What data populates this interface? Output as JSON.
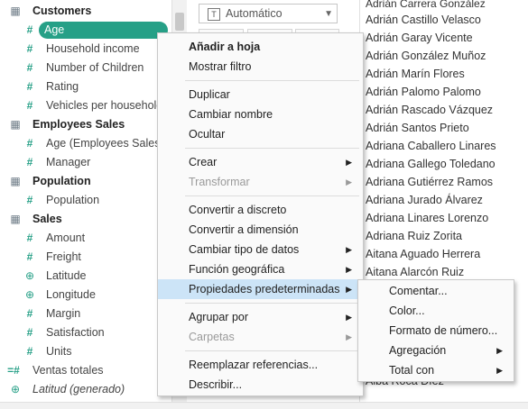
{
  "data_pane": {
    "tables": [
      {
        "name": "Customers",
        "fields": [
          "Age",
          "Household income",
          "Number of Children",
          "Rating",
          "Vehicles per household"
        ]
      },
      {
        "name": "Employees Sales",
        "fields": [
          "Age (Employees Sales)",
          "Manager"
        ]
      },
      {
        "name": "Population",
        "fields": [
          "Population"
        ]
      },
      {
        "name": "Sales",
        "fields": [
          "Amount",
          "Freight",
          "Latitude",
          "Longitude",
          "Margin",
          "Satisfaction",
          "Units"
        ]
      }
    ],
    "measure_names": [
      "Ventas totales",
      "Latitud (generado)"
    ]
  },
  "marks_card": {
    "type_label": "Automático"
  },
  "name_list": [
    "Adrián Carrera González",
    "Adrián Castillo Velasco",
    "Adrián Garay Vicente",
    "Adrián González Muñoz",
    "Adrián Marín Flores",
    "Adrián Palomo Palomo",
    "Adrián Rascado Vázquez",
    "Adrián Santos Prieto",
    "Adriana Caballero Linares",
    "Adriana Gallego Toledano",
    "Adriana Gutiérrez Ramos",
    "Adriana Jurado Álvarez",
    "Adriana Linares Lorenzo",
    "Adriana Ruiz Zorita",
    "Aitana Aguado Herrera",
    "Aitana Alarcón Ruiz",
    "Alba Roca Díez"
  ],
  "context_menu": {
    "items": [
      "Añadir a hoja",
      "Mostrar filtro",
      "Duplicar",
      "Cambiar nombre",
      "Ocultar",
      "Crear",
      "Transformar",
      "Convertir a discreto",
      "Convertir a dimensión",
      "Cambiar tipo de datos",
      "Función geográfica",
      "Propiedades predeterminadas",
      "Agrupar por",
      "Carpetas",
      "Reemplazar referencias...",
      "Describir..."
    ]
  },
  "submenu": {
    "items": [
      "Comentar...",
      "Color...",
      "Formato de número...",
      "Agregación",
      "Total con"
    ]
  },
  "icons": {
    "table": "table-icon",
    "measure": "measure-hash-icon",
    "geo": "globe-icon",
    "calc": "calculated-measure-icon",
    "submenu_arrow": "chevron-right-icon"
  },
  "colors": {
    "accent_pill": "#26a087",
    "menu_highlight": "#cce4f7"
  }
}
